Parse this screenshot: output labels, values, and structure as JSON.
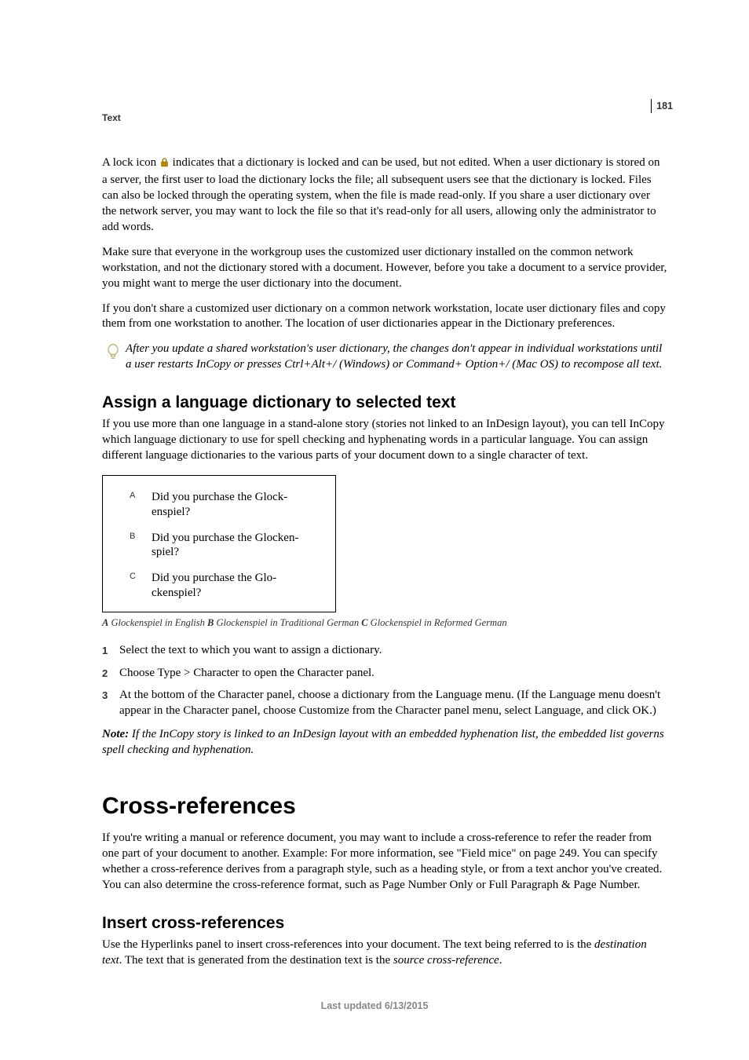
{
  "page_number": "181",
  "running_head": "Text",
  "para1_before_icon": "A lock icon ",
  "para1_after_icon": " indicates that a dictionary is locked and can be used, but not edited. When a user dictionary is stored on a server, the first user to load the dictionary locks the file; all subsequent users see that the dictionary is locked. Files can also be locked through the operating system, when the file is made read-only. If you share a user dictionary over the network server, you may want to lock the file so that it's read-only for all users, allowing only the administrator to add words.",
  "para2": "Make sure that everyone in the workgroup uses the customized user dictionary installed on the common network workstation, and not the dictionary stored with a document. However, before you take a document to a service provider, you might want to merge the user dictionary into the document.",
  "para3": "If you don't share a customized user dictionary on a common network workstation, locate user dictionary files and copy them from one workstation to another. The location of user dictionaries appear in the Dictionary preferences.",
  "tip": "After you update a shared workstation's user dictionary, the changes don't appear in individual workstations until a user restarts InCopy or presses Ctrl+Alt+/ (Windows) or Command+ Option+/ (Mac OS) to recompose all text.",
  "heading_assign": "Assign a language dictionary to selected text",
  "assign_intro": "If you use more than one language in a stand-alone story (stories not linked to an InDesign layout), you can tell InCopy which language dictionary to use for spell checking and hyphenating words in a particular language. You can assign different language dictionaries to the various parts of your document down to a single character of text.",
  "figure": {
    "a_label": "A",
    "a_text_line1": "Did you purchase the Glock-",
    "a_text_line2": "enspiel?",
    "b_label": "B",
    "b_text_line1": "Did you purchase the Glocken-",
    "b_text_line2": "spiel?",
    "c_label": "C",
    "c_text_line1": "Did you purchase the Glo-",
    "c_text_line2": "ckenspiel?"
  },
  "caption": {
    "a_key": "A",
    "a_text": " Glockenspiel in English  ",
    "b_key": "B",
    "b_text": " Glockenspiel in Traditional German  ",
    "c_key": "C",
    "c_text": " Glockenspiel in Reformed German"
  },
  "steps": [
    "Select the text to which you want to assign a dictionary.",
    "Choose Type > Character to open the Character panel.",
    "At the bottom of the Character panel, choose a dictionary from the Language menu. (If the Language menu doesn't appear in the Character panel, choose Customize from the Character panel menu, select Language, and click OK.)"
  ],
  "note_label": "Note:",
  "note_text": " If the InCopy story is linked to an InDesign layout with an embedded hyphenation list, the embedded list governs spell checking and hyphenation.",
  "chapter_heading": "Cross-references",
  "xref_intro": "If you're writing a manual or reference document, you may want to include a cross-reference to refer the reader from one part of your document to another. Example: For more information, see \"Field mice\" on page 249. You can specify whether a cross-reference derives from a paragraph style, such as a heading style, or from a text anchor you've created. You can also determine the cross-reference format, such as Page Number Only or Full Paragraph & Page Number.",
  "heading_insert": "Insert cross-references",
  "insert_p_before1": "Use the Hyperlinks panel to insert cross-references into your document. The text being referred to is the ",
  "insert_italic1": "destination text",
  "insert_p_mid": ". The text that is generated from the destination text is the ",
  "insert_italic2": "source cross-reference",
  "insert_p_after": ".",
  "footer": "Last updated 6/13/2015"
}
